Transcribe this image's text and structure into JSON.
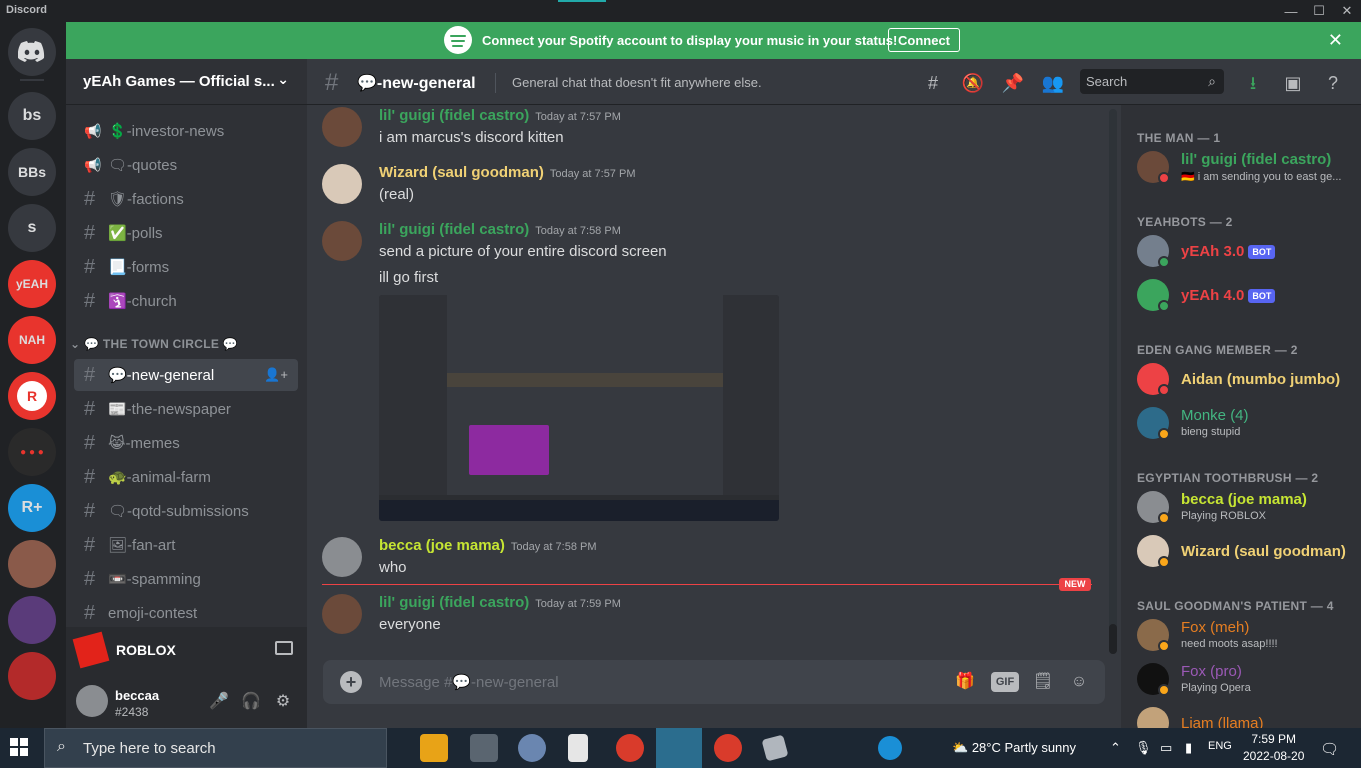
{
  "window": {
    "app_name": "Discord",
    "minimize": "—",
    "maximize": "☐",
    "close": "✕"
  },
  "guilds": [
    {
      "label": "bs",
      "color": "#36393f"
    },
    {
      "label": "BBs",
      "color": "#36393f"
    },
    {
      "label": "s",
      "color": "#36393f"
    },
    {
      "label": "yEAH",
      "color": "#e8342d"
    },
    {
      "label": "NAH",
      "color": "#e8342d"
    },
    {
      "label": "R",
      "color": "#e8342d"
    },
    {
      "label": "",
      "color": "#2a2a2a"
    },
    {
      "label": "R+",
      "color": "#1a8fd6"
    },
    {
      "label": "",
      "color": "#8a5a4a"
    },
    {
      "label": "",
      "color": "#5a3b7a"
    },
    {
      "label": "",
      "color": "#b32a2a"
    }
  ],
  "banner": {
    "text": "Connect your Spotify account to display your music in your status!",
    "button": "Connect",
    "close": "✕"
  },
  "server": {
    "name": "yEAh Games — Official s...",
    "chevron": "⌄"
  },
  "channels": [
    {
      "name": "💲-investor-news",
      "icon": "📢"
    },
    {
      "name": "🗨-quotes",
      "icon": "📢"
    },
    {
      "name": "🛡-factions",
      "icon": "#"
    },
    {
      "name": "✅-polls",
      "icon": "#"
    },
    {
      "name": "📃-forms",
      "icon": "#"
    },
    {
      "name": "🛐-church",
      "icon": "#"
    }
  ],
  "category": "⌄ 💬 THE TOWN CIRCLE 💬",
  "category_channels": [
    {
      "name": "💬-new-general",
      "active": true
    },
    {
      "name": "📰-the-newspaper",
      "active": false
    },
    {
      "name": "😹-memes",
      "active": false
    },
    {
      "name": "🐢-animal-farm",
      "active": false
    },
    {
      "name": "🗨-qotd-submissions",
      "active": false
    },
    {
      "name": "🖼-fan-art",
      "active": false
    },
    {
      "name": "📼-spamming",
      "active": false
    },
    {
      "name": "emoji-contest",
      "active": false
    }
  ],
  "activity": {
    "label": "ROBLOX"
  },
  "user": {
    "name": "beccaa",
    "tag": "#2438"
  },
  "chat": {
    "channel_name": "💬-new-general",
    "topic": "General chat that doesn't fit anywhere else.",
    "search_placeholder": "Search",
    "composer_placeholder": "Message #💬-new-general",
    "gif": "GIF",
    "new_label": "NEW"
  },
  "messages": [
    {
      "author": "lil' guigi (fidel castro)",
      "color": "#3ba55d",
      "time": "Today at 7:57 PM",
      "lines": [
        "i am marcus's discord kitten"
      ]
    },
    {
      "author": "Wizard (saul goodman)",
      "color": "#f0d175",
      "time": "Today at 7:57 PM",
      "lines": [
        "(real)"
      ]
    },
    {
      "author": "lil' guigi (fidel castro)",
      "color": "#3ba55d",
      "time": "Today at 7:58 PM",
      "lines": [
        "send a picture of your entire discord screen",
        "ill go first"
      ]
    },
    {
      "author": "becca (joe mama)",
      "color": "#c6e533",
      "time": "Today at 7:58 PM",
      "lines": [
        "who"
      ]
    },
    {
      "author": "lil' guigi (fidel castro)",
      "color": "#3ba55d",
      "time": "Today at 7:59 PM",
      "lines": [
        "everyone"
      ]
    }
  ],
  "members": {
    "groups": [
      {
        "title": "THE MAN — 1",
        "people": [
          {
            "name": "lil' guigi (fidel castro)",
            "color": "#3ba55d",
            "status": "🇩🇪 i am sending you to east ge...",
            "dot": "#ed4245",
            "avatar": "#6b4a3a"
          }
        ]
      },
      {
        "title": "YEAHBOTS — 2",
        "people": [
          {
            "name": "yEAh 3.0",
            "color": "#ed4245",
            "status": "",
            "bot": "BOT",
            "dot": "#3ba55d",
            "avatar": "#747f8d"
          },
          {
            "name": "yEAh 4.0",
            "color": "#ed4245",
            "status": "",
            "bot": "BOT",
            "dot": "#3ba55d",
            "avatar": "#3ba55d"
          }
        ]
      },
      {
        "title": "EDEN GANG MEMBER — 2",
        "people": [
          {
            "name": "Aidan (mumbo jumbo)",
            "color": "#f0d175",
            "status": "",
            "dot": "#ed4245",
            "avatar": "#ed4245"
          },
          {
            "name": "Monke (4)",
            "color": "#43b581",
            "status": "bieng stupid",
            "dot": "#faa61a",
            "avatar": "#2d6b8a"
          }
        ]
      },
      {
        "title": "EGYPTIAN TOOTHBRUSH — 2",
        "people": [
          {
            "name": "becca (joe mama)",
            "color": "#c6e533",
            "status": "Playing ROBLOX",
            "dot": "#faa61a",
            "avatar": "#8a8d91"
          },
          {
            "name": "Wizard (saul goodman)",
            "color": "#f0d175",
            "status": "",
            "dot": "#faa61a",
            "avatar": "#d9c9b8"
          }
        ]
      },
      {
        "title": "SAUL GOODMAN'S PATIENT — 4",
        "people": [
          {
            "name": "Fox (meh)",
            "color": "#e67e22",
            "status": "need moots asap!!!!",
            "dot": "#faa61a",
            "avatar": "#8a6a4a"
          },
          {
            "name": "Fox (pro)",
            "color": "#9b59b6",
            "status": "Playing Opera",
            "dot": "#faa61a",
            "avatar": "#111111"
          },
          {
            "name": "Liam (llama)",
            "color": "#e67e22",
            "status": "",
            "dot": "#faa61a",
            "avatar": "#c2a27a"
          }
        ]
      }
    ]
  },
  "taskbar": {
    "search_placeholder": "Type here to search",
    "weather": "28°C  Partly sunny",
    "lang": "ENG",
    "time": "7:59 PM",
    "date": "2022-08-20"
  }
}
